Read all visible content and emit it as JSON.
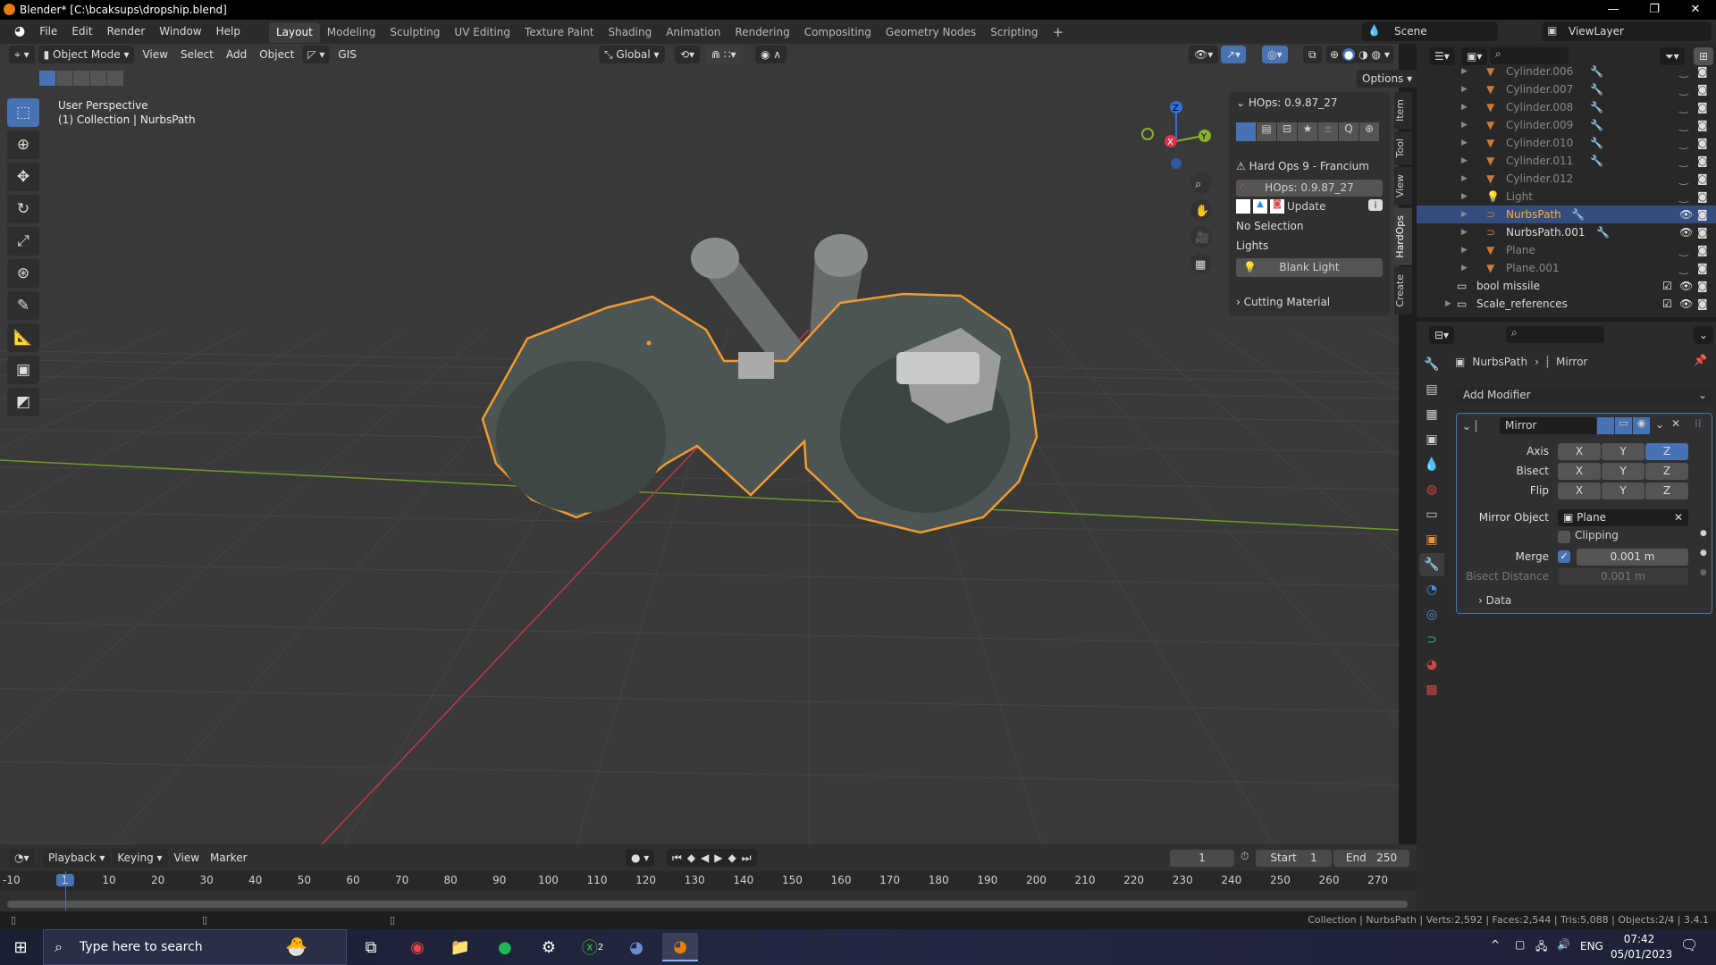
{
  "window": {
    "title": "Blender* [C:\\bcaksups\\dropship.blend]",
    "minimize": "—",
    "maximize": "❐",
    "close": "✕"
  },
  "menu": {
    "items": [
      "File",
      "Edit",
      "Render",
      "Window",
      "Help"
    ],
    "workspaces": [
      "Layout",
      "Modeling",
      "Sculpting",
      "UV Editing",
      "Texture Paint",
      "Shading",
      "Animation",
      "Rendering",
      "Compositing",
      "Geometry Nodes",
      "Scripting"
    ],
    "add_workspace": "+",
    "active_workspace": "Layout",
    "scene": "Scene",
    "view_layer": "ViewLayer"
  },
  "viewport": {
    "mode": "Object Mode",
    "menus": [
      "View",
      "Select",
      "Add",
      "Object"
    ],
    "gis": "GIS",
    "transform_orientation": "Global",
    "options": "Options",
    "perspective": "User Perspective",
    "collection_info": "(1) Collection | NurbsPath",
    "gizmo": {
      "x": "X",
      "y": "Y",
      "z": "Z"
    },
    "colors": {
      "selection_outline": "#f29a2e",
      "x_axis": "#c0394b",
      "y_axis": "#6e9a2a",
      "accent": "#4772b3"
    }
  },
  "tools": [
    "select-box",
    "cursor",
    "move",
    "rotate",
    "scale",
    "transform",
    "annotate",
    "measure",
    "add-cube",
    "extrude"
  ],
  "hops": {
    "header": "HOps: 0.9.87_27",
    "warning": "Hard Ops 9 - Francium",
    "version_button": "HOps: 0.9.87_27",
    "update": "Update",
    "no_selection": "No Selection",
    "lights": "Lights",
    "blank_light": "Blank Light",
    "cutting_material": "Cutting Material"
  },
  "ntabs": [
    "Item",
    "Tool",
    "View",
    "HardOps",
    "Create"
  ],
  "ntab_active": "HardOps",
  "outliner": {
    "items": [
      {
        "name": "Cylinder.006",
        "type": "mesh",
        "mod": true,
        "visible": false
      },
      {
        "name": "Cylinder.007",
        "type": "mesh",
        "mod": true,
        "visible": false
      },
      {
        "name": "Cylinder.008",
        "type": "mesh",
        "mod": true,
        "visible": false
      },
      {
        "name": "Cylinder.009",
        "type": "mesh",
        "mod": true,
        "visible": false
      },
      {
        "name": "Cylinder.010",
        "type": "mesh",
        "mod": true,
        "visible": false
      },
      {
        "name": "Cylinder.011",
        "type": "mesh",
        "mod": true,
        "visible": false
      },
      {
        "name": "Cylinder.012",
        "type": "mesh",
        "mod": false,
        "visible": false
      },
      {
        "name": "Light",
        "type": "light",
        "mod": false,
        "visible": false
      },
      {
        "name": "NurbsPath",
        "type": "curve",
        "mod": true,
        "visible": true,
        "selected": true
      },
      {
        "name": "NurbsPath.001",
        "type": "curve",
        "mod": true,
        "visible": true
      },
      {
        "name": "Plane",
        "type": "mesh",
        "mod": false,
        "visible": false
      },
      {
        "name": "Plane.001",
        "type": "mesh",
        "mod": false,
        "visible": false
      },
      {
        "name": "bool missile",
        "type": "collection",
        "checked": true,
        "visible": true
      },
      {
        "name": "Scale_references",
        "type": "collection",
        "checked": true,
        "visible": true
      }
    ]
  },
  "properties": {
    "breadcrumb": {
      "object": "NurbsPath",
      "modifier": "Mirror"
    },
    "add_modifier": "Add Modifier",
    "modifier": {
      "name": "Mirror",
      "axis_label": "Axis",
      "bisect_label": "Bisect",
      "flip_label": "Flip",
      "axes": [
        "X",
        "Y",
        "Z"
      ],
      "axis_active": "Z",
      "mirror_object_label": "Mirror Object",
      "mirror_object": "Plane",
      "clipping_label": "Clipping",
      "clipping": false,
      "merge_label": "Merge",
      "merge": true,
      "merge_value": "0.001 m",
      "bisect_distance_label": "Bisect Distance",
      "bisect_distance": "0.001 m",
      "data_label": "Data"
    }
  },
  "timeline": {
    "menus": [
      "Playback",
      "Keying",
      "View",
      "Marker"
    ],
    "current_frame": "1",
    "start_label": "Start",
    "start": "1",
    "end_label": "End",
    "end": "250",
    "ticks": [
      "-10",
      "1",
      "10",
      "20",
      "30",
      "40",
      "50",
      "60",
      "70",
      "80",
      "90",
      "100",
      "110",
      "120",
      "130",
      "140",
      "150",
      "160",
      "170",
      "180",
      "190",
      "200",
      "210",
      "220",
      "230",
      "240",
      "250",
      "260",
      "270"
    ]
  },
  "status": {
    "text": "Collection | NurbsPath | Verts:2,592 | Faces:2,544 | Tris:5,088 | Objects:2/4 | 3.4.1"
  },
  "taskbar": {
    "search_placeholder": "Type here to search",
    "language": "ENG",
    "time": "07:42",
    "date": "05/01/2023",
    "xbox_badge": "2"
  }
}
